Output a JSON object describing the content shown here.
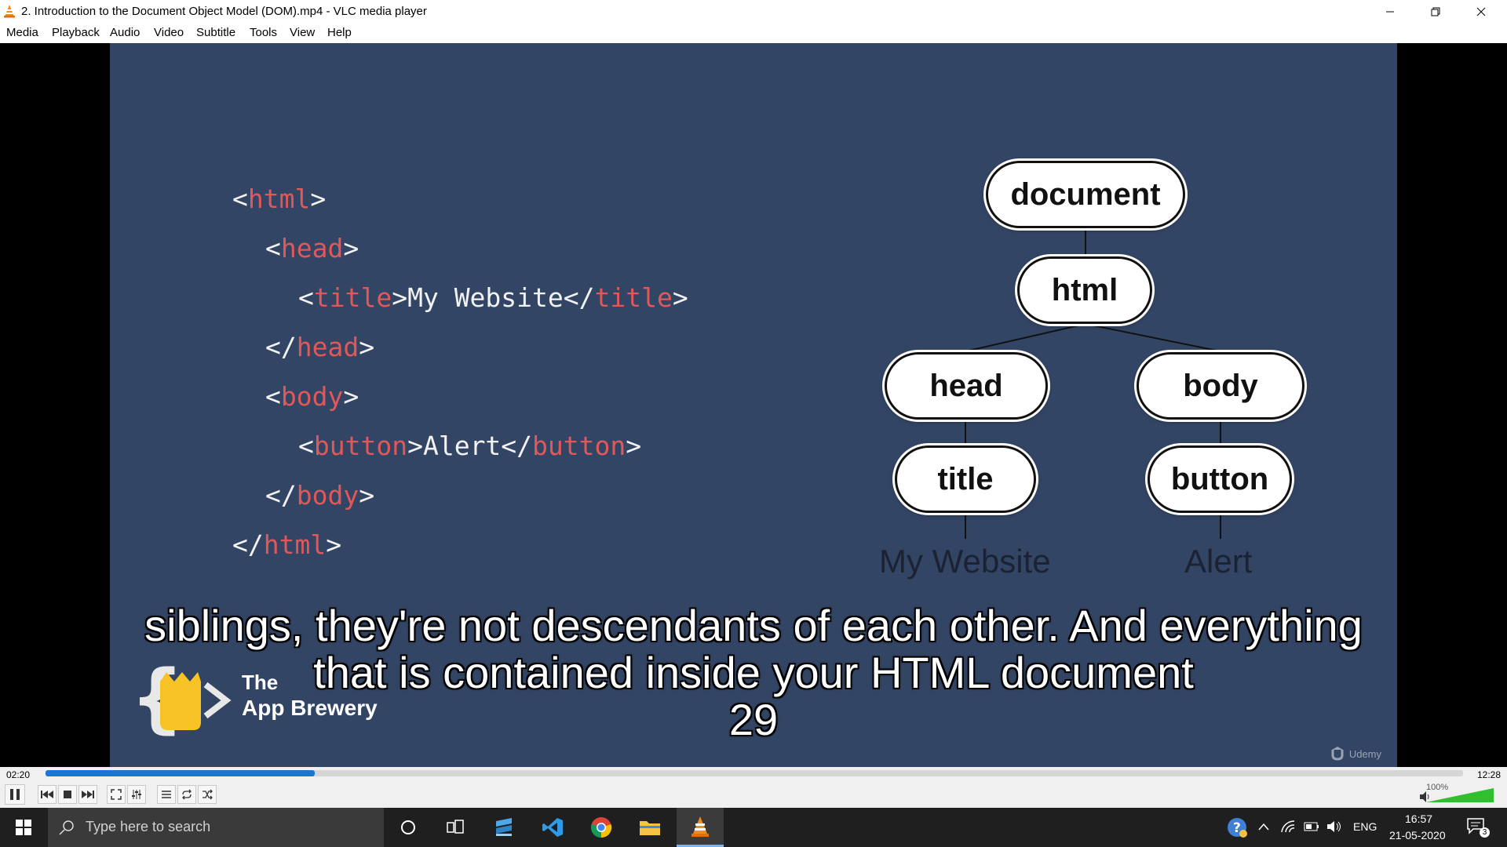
{
  "window": {
    "title": "2. Introduction to the Document Object Model (DOM).mp4 - VLC media player"
  },
  "menu": [
    "Media",
    "Playback",
    "Audio",
    "Video",
    "Subtitle",
    "Tools",
    "View",
    "Help"
  ],
  "slide": {
    "code_lines": [
      {
        "segments": [
          [
            "<",
            false
          ],
          [
            "html",
            true
          ],
          [
            ">",
            false
          ]
        ]
      },
      {
        "segments": [
          [
            "<",
            false
          ],
          [
            "head",
            true
          ],
          [
            ">",
            false
          ]
        ]
      },
      {
        "segments": [
          [
            "<",
            false
          ],
          [
            "title",
            true
          ],
          [
            ">My Website</",
            false
          ],
          [
            "title",
            true
          ],
          [
            ">",
            false
          ]
        ]
      },
      {
        "segments": [
          [
            "</",
            false
          ],
          [
            "head",
            true
          ],
          [
            ">",
            false
          ]
        ]
      },
      {
        "segments": [
          [
            "<",
            false
          ],
          [
            "body",
            true
          ],
          [
            ">",
            false
          ]
        ]
      },
      {
        "segments": [
          [
            "<",
            false
          ],
          [
            "button",
            true
          ],
          [
            ">Alert</",
            false
          ],
          [
            "button",
            true
          ],
          [
            ">",
            false
          ]
        ]
      },
      {
        "segments": [
          [
            "</",
            false
          ],
          [
            "body",
            true
          ],
          [
            ">",
            false
          ]
        ]
      },
      {
        "segments": [
          [
            "</",
            false
          ],
          [
            "html",
            true
          ],
          [
            ">",
            false
          ]
        ]
      }
    ],
    "tree": {
      "document": "document",
      "html": "html",
      "head": "head",
      "body": "body",
      "title": "title",
      "button": "button",
      "title_text": "My Website",
      "button_text": "Alert"
    },
    "brand": {
      "line1": "The",
      "line2": "App Brewery"
    },
    "udemy": "Udemy"
  },
  "subtitles": {
    "line1": "siblings, they're not descendants of each other. And everything",
    "line2": "that is contained inside your HTML document",
    "line3": "29"
  },
  "player": {
    "elapsed": "02:20",
    "total": "12:28",
    "progress_fraction": 0.19,
    "volume": "100%",
    "volume_fraction": 1.0
  },
  "taskbar": {
    "search_placeholder": "Type here to search",
    "language": "ENG",
    "time": "16:57",
    "date": "21-05-2020",
    "notification_count": "3"
  }
}
